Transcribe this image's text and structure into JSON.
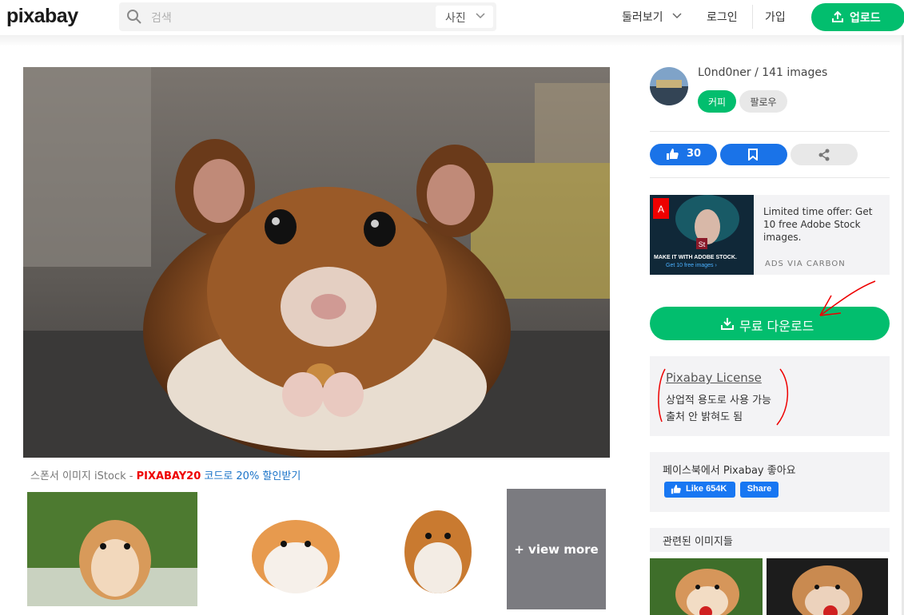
{
  "header": {
    "logo": "pixabay",
    "search_placeholder": "검색",
    "search_type": "사진",
    "explore": "둘러보기",
    "login": "로그인",
    "join": "가입",
    "upload": "업로드"
  },
  "main": {
    "sponsor_prefix": "스폰서 이미지 iStock - ",
    "sponsor_code": "PIXABAY20",
    "sponsor_link": " 코드로 20% 할인받기",
    "view_more": "+ view more"
  },
  "sidebar": {
    "author": "L0nd0ner / 141 images",
    "coffee": "커피",
    "follow": "팔로우",
    "likes": "30",
    "ad_text": "Limited time offer: Get 10 free Adobe Stock images.",
    "ad_via": "ADS VIA CARBON",
    "ad_banner_line1": "MAKE IT WITH ADOBE STOCK.",
    "ad_banner_line2": "Get 10 free images ›",
    "download": "무료 다운로드",
    "license_title": "Pixabay License",
    "license_line1": "상업적 용도로 사용 가능",
    "license_line2": "출처 안 밝혀도 됨",
    "facebook_text": "페이스북에서 Pixabay 좋아요",
    "fb_like": "Like 654K",
    "fb_share": "Share",
    "related_title": "관련된 이미지들"
  },
  "colors": {
    "brand_green": "#02be6e",
    "blue": "#1a73e8",
    "sponsor_code": "#ee0000"
  }
}
